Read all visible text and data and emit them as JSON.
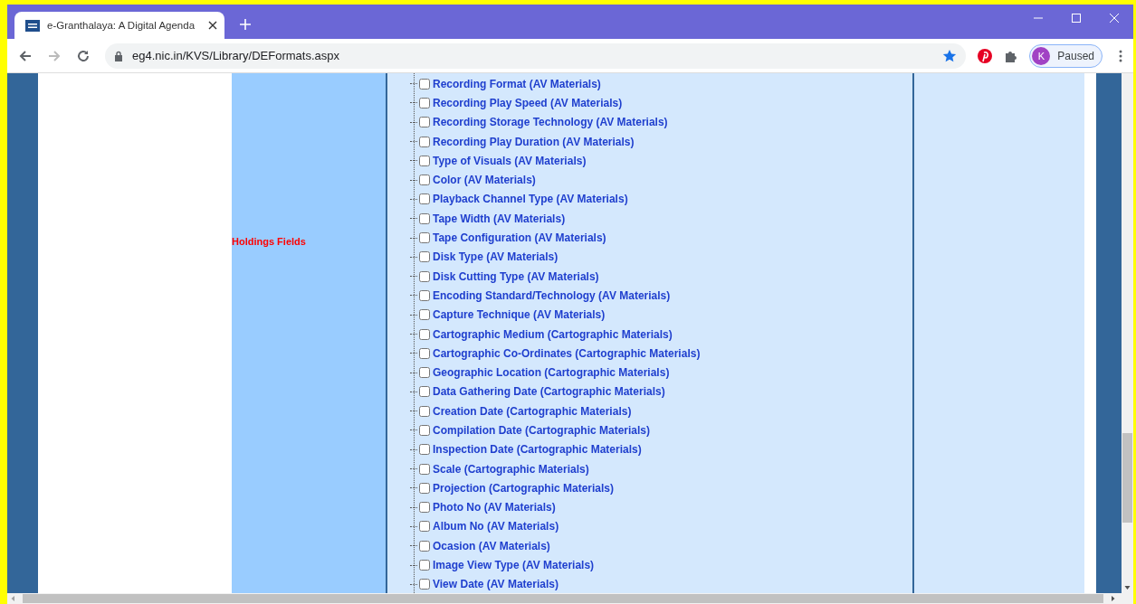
{
  "browser": {
    "tab": {
      "title": "e-Granthalaya: A Digital Agenda",
      "selected": true
    },
    "url": "eg4.nic.in/KVS/Library/DEFormats.aspx",
    "bookmarked": true,
    "profile": {
      "initial": "K",
      "status": "Paused"
    }
  },
  "page": {
    "section_label": "Holdings Fields",
    "items": [
      {
        "label": "Recording Format (AV Materials)",
        "checked": false
      },
      {
        "label": "Recording Play Speed (AV Materials)",
        "checked": false
      },
      {
        "label": "Recording Storage Technology (AV Materials)",
        "checked": false
      },
      {
        "label": "Recording Play Duration (AV Materials)",
        "checked": false
      },
      {
        "label": "Type of Visuals (AV Materials)",
        "checked": false
      },
      {
        "label": "Color (AV Materials)",
        "checked": false
      },
      {
        "label": "Playback Channel Type (AV Materials)",
        "checked": false
      },
      {
        "label": "Tape Width (AV Materials)",
        "checked": false
      },
      {
        "label": "Tape Configuration (AV Materials)",
        "checked": false
      },
      {
        "label": "Disk Type (AV Materials)",
        "checked": false
      },
      {
        "label": "Disk Cutting Type (AV Materials)",
        "checked": false
      },
      {
        "label": "Encoding Standard/Technology (AV Materials)",
        "checked": false
      },
      {
        "label": "Capture Technique (AV Materials)",
        "checked": false
      },
      {
        "label": "Cartographic Medium (Cartographic Materials)",
        "checked": false
      },
      {
        "label": "Cartographic Co-Ordinates (Cartographic Materials)",
        "checked": false
      },
      {
        "label": "Geographic Location (Cartographic Materials)",
        "checked": false
      },
      {
        "label": "Data Gathering Date (Cartographic Materials)",
        "checked": false
      },
      {
        "label": "Creation Date (Cartographic Materials)",
        "checked": false
      },
      {
        "label": "Compilation Date (Cartographic Materials)",
        "checked": false
      },
      {
        "label": "Inspection Date (Cartographic Materials)",
        "checked": false
      },
      {
        "label": "Scale (Cartographic Materials)",
        "checked": false
      },
      {
        "label": "Projection (Cartographic Materials)",
        "checked": false
      },
      {
        "label": "Photo No (AV Materials)",
        "checked": false
      },
      {
        "label": "Album No (AV Materials)",
        "checked": false
      },
      {
        "label": "Ocasion (AV Materials)",
        "checked": false
      },
      {
        "label": "Image View Type (AV Materials)",
        "checked": false
      },
      {
        "label": "View Date (AV Materials)",
        "checked": false
      }
    ]
  }
}
